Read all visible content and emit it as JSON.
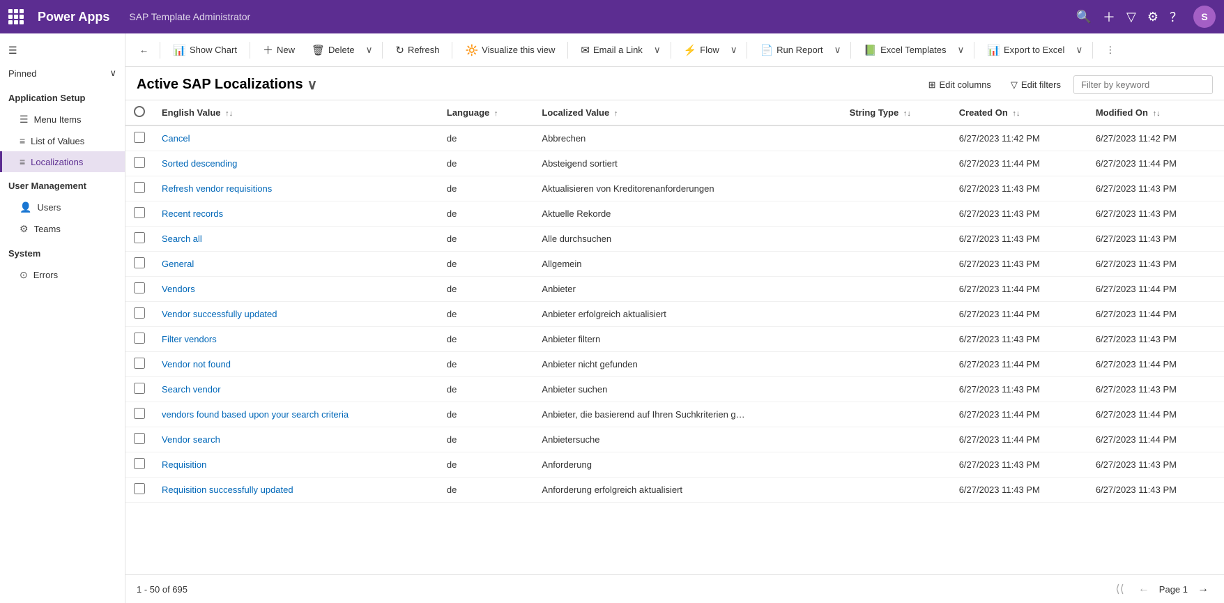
{
  "topBar": {
    "appTitle": "Power Apps",
    "subtitle": "SAP Template Administrator",
    "icons": [
      "search",
      "plus",
      "filter",
      "settings",
      "help"
    ]
  },
  "sidebar": {
    "collapseLabel": "Collapse",
    "pinned": "Pinned",
    "sections": [
      {
        "title": "Application Setup",
        "items": [
          {
            "label": "Menu Items",
            "icon": "☰",
            "active": false
          },
          {
            "label": "List of Values",
            "icon": "≡",
            "active": false
          },
          {
            "label": "Localizations",
            "icon": "≡",
            "active": true
          }
        ]
      },
      {
        "title": "User Management",
        "items": [
          {
            "label": "Users",
            "icon": "👤",
            "active": false
          },
          {
            "label": "Teams",
            "icon": "⚙",
            "active": false
          }
        ]
      },
      {
        "title": "System",
        "items": [
          {
            "label": "Errors",
            "icon": "⊙",
            "active": false
          }
        ]
      }
    ]
  },
  "toolbar": {
    "backBtn": "←",
    "showChart": "Show Chart",
    "new": "New",
    "delete": "Delete",
    "refresh": "Refresh",
    "visualize": "Visualize this view",
    "emailLink": "Email a Link",
    "flow": "Flow",
    "runReport": "Run Report",
    "excelTemplates": "Excel Templates",
    "exportToExcel": "Export to Excel",
    "more": "⋮"
  },
  "viewHeader": {
    "title": "Active SAP Localizations",
    "editColumns": "Edit columns",
    "editFilters": "Edit filters",
    "filterPlaceholder": "Filter by keyword"
  },
  "table": {
    "columns": [
      {
        "label": "",
        "key": "checkbox"
      },
      {
        "label": "English Value",
        "sort": "↑↓",
        "key": "englishValue"
      },
      {
        "label": "Language",
        "sort": "↑",
        "key": "language"
      },
      {
        "label": "Localized Value",
        "sort": "↑",
        "key": "localizedValue"
      },
      {
        "label": "String Type",
        "sort": "↑↓",
        "key": "stringType"
      },
      {
        "label": "Created On",
        "sort": "↑↓",
        "key": "createdOn"
      },
      {
        "label": "Modified On",
        "sort": "↑↓",
        "key": "modifiedOn"
      }
    ],
    "rows": [
      {
        "englishValue": "Cancel",
        "language": "de",
        "localizedValue": "Abbrechen",
        "stringType": "",
        "createdOn": "6/27/2023 11:42 PM",
        "modifiedOn": "6/27/2023 11:42 PM"
      },
      {
        "englishValue": "Sorted descending",
        "language": "de",
        "localizedValue": "Absteigend sortiert",
        "stringType": "",
        "createdOn": "6/27/2023 11:44 PM",
        "modifiedOn": "6/27/2023 11:44 PM"
      },
      {
        "englishValue": "Refresh vendor requisitions",
        "language": "de",
        "localizedValue": "Aktualisieren von Kreditorenanforderungen",
        "stringType": "",
        "createdOn": "6/27/2023 11:43 PM",
        "modifiedOn": "6/27/2023 11:43 PM"
      },
      {
        "englishValue": "Recent records",
        "language": "de",
        "localizedValue": "Aktuelle Rekorde",
        "stringType": "",
        "createdOn": "6/27/2023 11:43 PM",
        "modifiedOn": "6/27/2023 11:43 PM"
      },
      {
        "englishValue": "Search all",
        "language": "de",
        "localizedValue": "Alle durchsuchen",
        "stringType": "",
        "createdOn": "6/27/2023 11:43 PM",
        "modifiedOn": "6/27/2023 11:43 PM"
      },
      {
        "englishValue": "General",
        "language": "de",
        "localizedValue": "Allgemein",
        "stringType": "",
        "createdOn": "6/27/2023 11:43 PM",
        "modifiedOn": "6/27/2023 11:43 PM"
      },
      {
        "englishValue": "Vendors",
        "language": "de",
        "localizedValue": "Anbieter",
        "stringType": "",
        "createdOn": "6/27/2023 11:44 PM",
        "modifiedOn": "6/27/2023 11:44 PM"
      },
      {
        "englishValue": "Vendor successfully updated",
        "language": "de",
        "localizedValue": "Anbieter erfolgreich aktualisiert",
        "stringType": "",
        "createdOn": "6/27/2023 11:44 PM",
        "modifiedOn": "6/27/2023 11:44 PM"
      },
      {
        "englishValue": "Filter vendors",
        "language": "de",
        "localizedValue": "Anbieter filtern",
        "stringType": "",
        "createdOn": "6/27/2023 11:43 PM",
        "modifiedOn": "6/27/2023 11:43 PM"
      },
      {
        "englishValue": "Vendor not found",
        "language": "de",
        "localizedValue": "Anbieter nicht gefunden",
        "stringType": "",
        "createdOn": "6/27/2023 11:44 PM",
        "modifiedOn": "6/27/2023 11:44 PM"
      },
      {
        "englishValue": "Search vendor",
        "language": "de",
        "localizedValue": "Anbieter suchen",
        "stringType": "",
        "createdOn": "6/27/2023 11:43 PM",
        "modifiedOn": "6/27/2023 11:43 PM"
      },
      {
        "englishValue": "vendors found based upon your search criteria",
        "language": "de",
        "localizedValue": "Anbieter, die basierend auf Ihren Suchkriterien g…",
        "stringType": "",
        "createdOn": "6/27/2023 11:44 PM",
        "modifiedOn": "6/27/2023 11:44 PM"
      },
      {
        "englishValue": "Vendor search",
        "language": "de",
        "localizedValue": "Anbietersuche",
        "stringType": "",
        "createdOn": "6/27/2023 11:44 PM",
        "modifiedOn": "6/27/2023 11:44 PM"
      },
      {
        "englishValue": "Requisition",
        "language": "de",
        "localizedValue": "Anforderung",
        "stringType": "",
        "createdOn": "6/27/2023 11:43 PM",
        "modifiedOn": "6/27/2023 11:43 PM"
      },
      {
        "englishValue": "Requisition successfully updated",
        "language": "de",
        "localizedValue": "Anforderung erfolgreich aktualisiert",
        "stringType": "",
        "createdOn": "6/27/2023 11:43 PM",
        "modifiedOn": "6/27/2023 11:43 PM"
      }
    ]
  },
  "footer": {
    "recordCount": "1 - 50 of 695",
    "pageLabel": "Page 1",
    "firstPage": "⟨⟨",
    "prevPage": "←",
    "nextPage": "→"
  }
}
